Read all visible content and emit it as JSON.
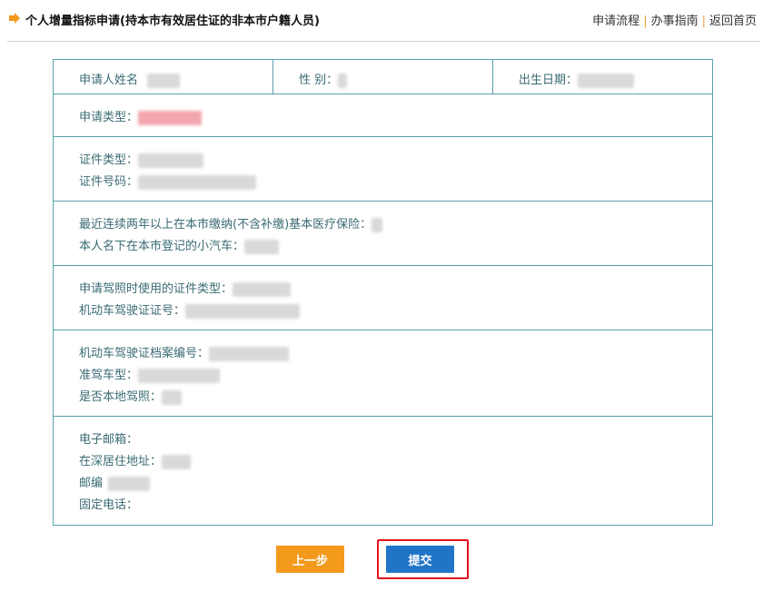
{
  "header": {
    "title": "个人增量指标申请(持本市有效居住证的非本市户籍人员)",
    "links": [
      "申请流程",
      "办事指南",
      "返回首页"
    ],
    "separator": "|"
  },
  "form": {
    "applicant_name_label": "申请人姓名",
    "gender_label": "性 别：",
    "birth_date_label": "出生日期：",
    "application_type_label": "申请类型：",
    "id_type_label": "证件类型：",
    "id_number_label": "证件号码：",
    "insurance_label": "最近连续两年以上在本市缴纳(不含补缴)基本医疗保险：",
    "car_label": "本人名下在本市登记的小汽车：",
    "license_id_type_label": "申请驾照时使用的证件类型：",
    "license_number_label": "机动车驾驶证证号：",
    "license_file_label": "机动车驾驶证档案编号：",
    "vehicle_class_label": "准驾车型：",
    "local_license_label": "是否本地驾照：",
    "email_label": "电子邮箱：",
    "address_label": "在深居住地址：",
    "postcode_label": "邮编",
    "phone_label": "固定电话："
  },
  "buttons": {
    "prev": "上一步",
    "submit": "提交"
  },
  "colors": {
    "border": "#5a9fb0",
    "label_text": "#3a6b73",
    "prev_button": "#f39a1c",
    "submit_button": "#2175c7",
    "highlight": "#e0141a",
    "separator": "#e9a23b"
  }
}
